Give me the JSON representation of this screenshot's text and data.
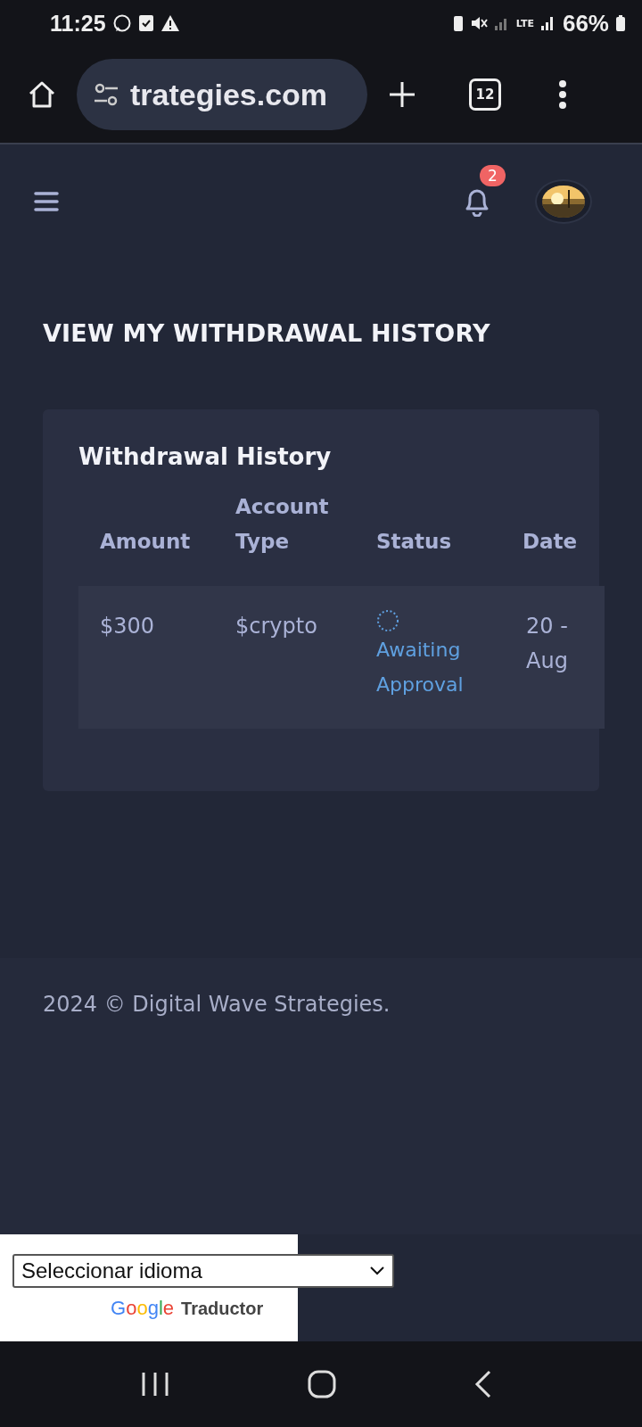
{
  "status_bar": {
    "time": "11:25",
    "network": "LTE",
    "battery": "66%"
  },
  "browser": {
    "url": "trategies.com",
    "tab_count": "12"
  },
  "header": {
    "notification_count": "2"
  },
  "page_title": "VIEW MY WITHDRAWAL HISTORY",
  "card": {
    "title": "Withdrawal History",
    "table": {
      "columns": [
        "Amount",
        "Account Type",
        "Status",
        "Date"
      ],
      "rows": [
        {
          "amount": "$300",
          "account_type": "$crypto",
          "status": "Awaiting Approval",
          "date": "20 - Aug"
        }
      ]
    }
  },
  "footer": {
    "text": "2024 © Digital Wave Strategies."
  },
  "translate": {
    "select": "Seleccionar idioma",
    "brand": "Google",
    "label": "Traductor"
  }
}
